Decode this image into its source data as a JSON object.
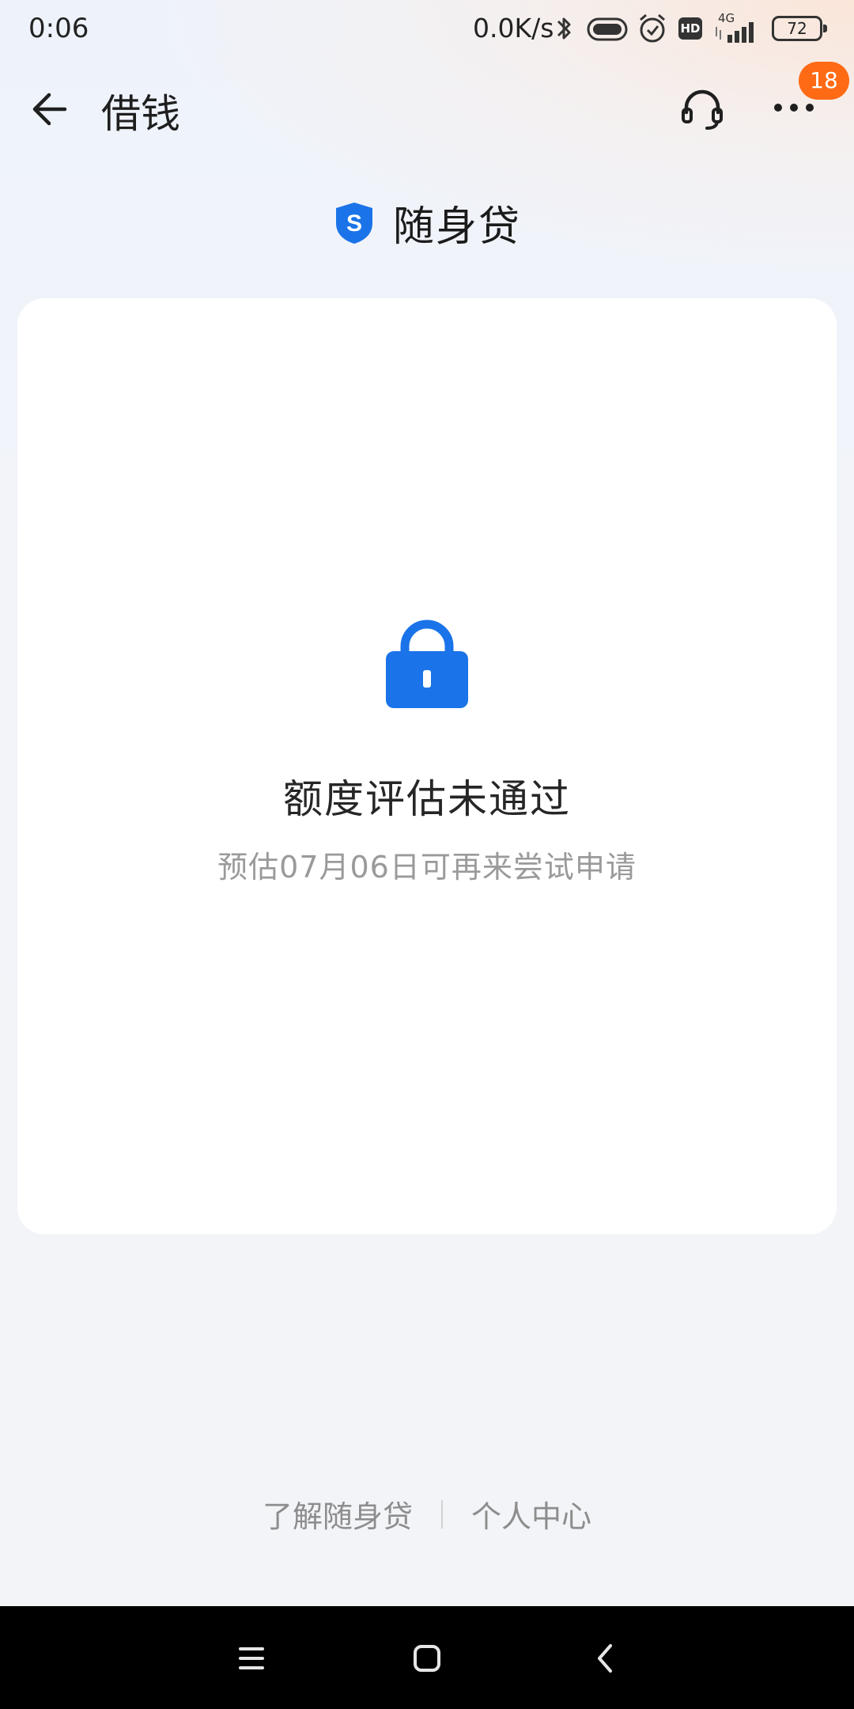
{
  "status_bar": {
    "time": "0:06",
    "network_speed": "0.0K/s",
    "network_type": "4G",
    "hd_label": "HD",
    "battery": "72"
  },
  "header": {
    "title": "借钱",
    "notification_count": "18"
  },
  "brand": {
    "logo_letter": "S",
    "name": "随身贷"
  },
  "result": {
    "title": "额度评估未通过",
    "subtitle": "预估07月06日可再来尝试申请"
  },
  "footer_links": {
    "learn": "了解随身贷",
    "personal_center": "个人中心"
  },
  "colors": {
    "accent": "#1a73e8",
    "badge": "#ff6a15"
  }
}
